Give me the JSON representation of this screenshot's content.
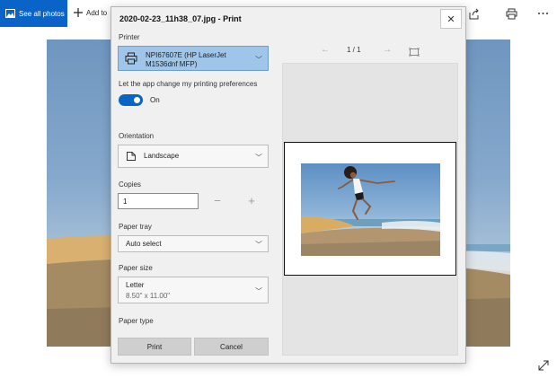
{
  "topbar": {
    "see_all_label": "See all photos",
    "add_to_label": "Add to",
    "accent": "#0a64c8"
  },
  "dialog": {
    "title": "2020-02-23_11h38_07.jpg - Print",
    "close_glyph": "✕",
    "printer": {
      "label": "Printer",
      "value": "NPI67607E (HP LaserJet M1536dnf MFP)"
    },
    "app_prefs": {
      "label": "Let the app change my printing preferences",
      "state": "On"
    },
    "orientation": {
      "label": "Orientation",
      "value": "Landscape"
    },
    "copies": {
      "label": "Copies",
      "value": "1",
      "minus": "−",
      "plus": "+"
    },
    "paper_tray": {
      "label": "Paper tray",
      "value": "Auto select"
    },
    "paper_size": {
      "label": "Paper size",
      "value": "Letter",
      "sub": "8.50\" x 11.00\""
    },
    "paper_type": {
      "label": "Paper type"
    },
    "buttons": {
      "print": "Print",
      "cancel": "Cancel"
    },
    "preview": {
      "page_indicator": "1 / 1",
      "prev_glyph": "←",
      "next_glyph": "→"
    }
  },
  "icons": [
    "photos-icon",
    "plus-icon",
    "share-icon",
    "print-icon",
    "more-icon",
    "printer-icon",
    "page-icon",
    "chevron-down-icon",
    "fit-page-icon",
    "expand-icon",
    "close-icon"
  ]
}
